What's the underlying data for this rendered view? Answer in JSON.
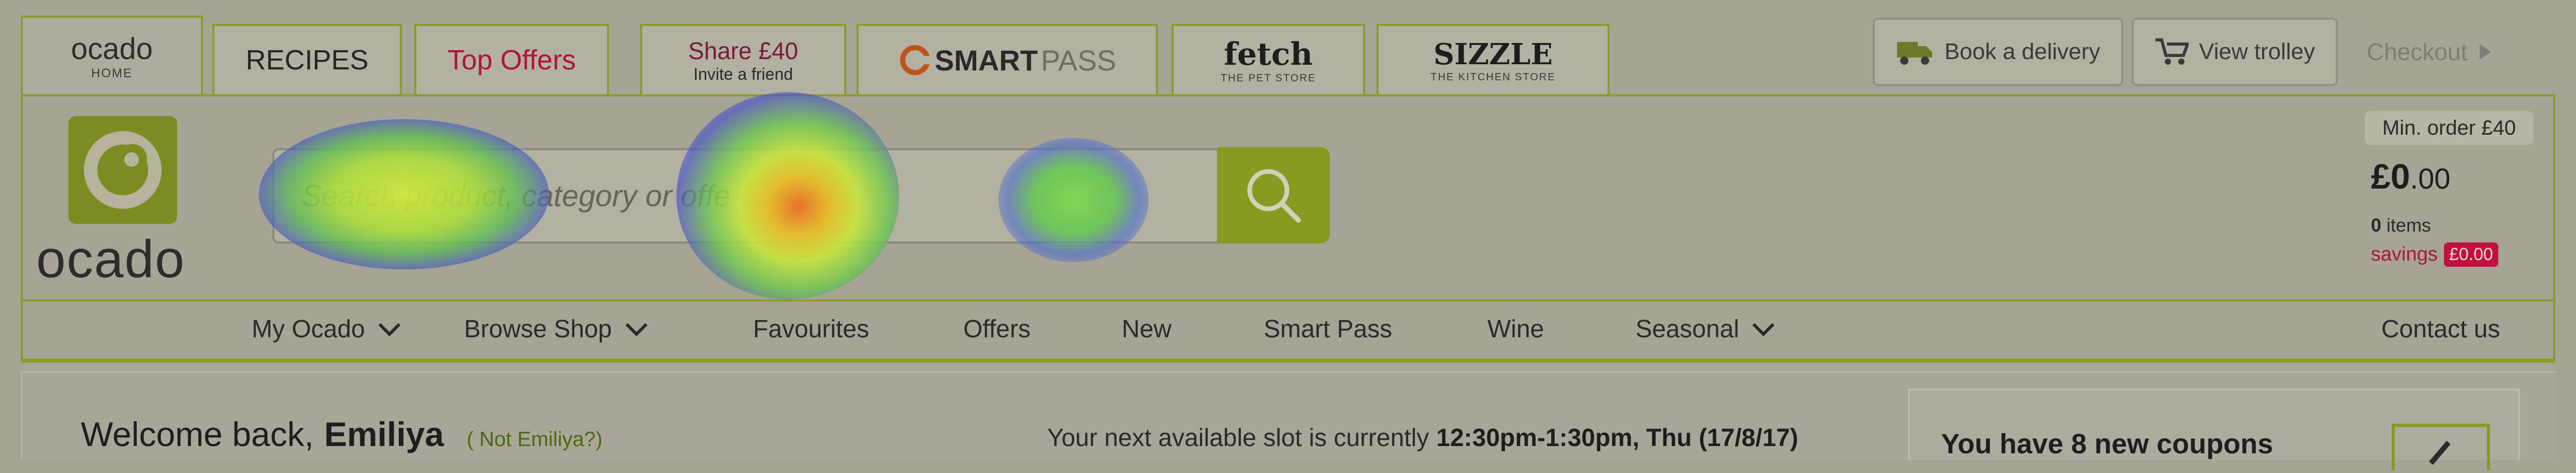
{
  "colors": {
    "accent_green": "#889a20",
    "tab_border": "#8f9a2a",
    "offers_red": "#b0143a",
    "savings_red": "#c1123e",
    "background": "#a7a496"
  },
  "tabs": {
    "home": {
      "main": "ocado",
      "sub": "HOME"
    },
    "recipes": "RECIPES",
    "top_offers": "Top Offers",
    "share": {
      "main": "Share £40",
      "sub": "Invite a friend"
    },
    "smartpass": {
      "smart": "SMART",
      "pass": "PASS"
    },
    "fetch": {
      "main": "fetch",
      "sub": "THE PET STORE"
    },
    "sizzle": {
      "main": "SIZZLE",
      "sub": "THE KITCHEN STORE"
    }
  },
  "actions": {
    "book_delivery": "Book a delivery",
    "view_trolley": "View trolley",
    "checkout": "Checkout"
  },
  "logo": {
    "text": "ocado"
  },
  "search": {
    "placeholder": "Search product, category or offe"
  },
  "basket": {
    "min_order": "Min. order £40",
    "total_main": "£0",
    "total_pence": ".00",
    "items_count": "0",
    "items_label": "items",
    "savings_label": "savings",
    "savings_value": "£0.00"
  },
  "nav": {
    "my_ocado": "My Ocado",
    "browse_shop": "Browse Shop",
    "favourites": "Favourites",
    "offers": "Offers",
    "new": "New",
    "smart_pass": "Smart Pass",
    "wine": "Wine",
    "seasonal": "Seasonal",
    "contact": "Contact us"
  },
  "welcome": {
    "prefix": "Welcome back,",
    "name": "Emiliya",
    "not_user": "( Not Emiliya?)"
  },
  "slot": {
    "prefix": "Your next available slot is currently",
    "value": "12:30pm-1:30pm, Thu (17/8/17)"
  },
  "coupons": {
    "text": "You have 8 new coupons"
  },
  "icons": [
    "delivery-van-icon",
    "trolley-icon",
    "checkout-arrow-icon",
    "search-icon",
    "smartpass-logo-icon",
    "ocado-logo-icon",
    "chevron-down-icon",
    "coupon-tick-icon"
  ]
}
